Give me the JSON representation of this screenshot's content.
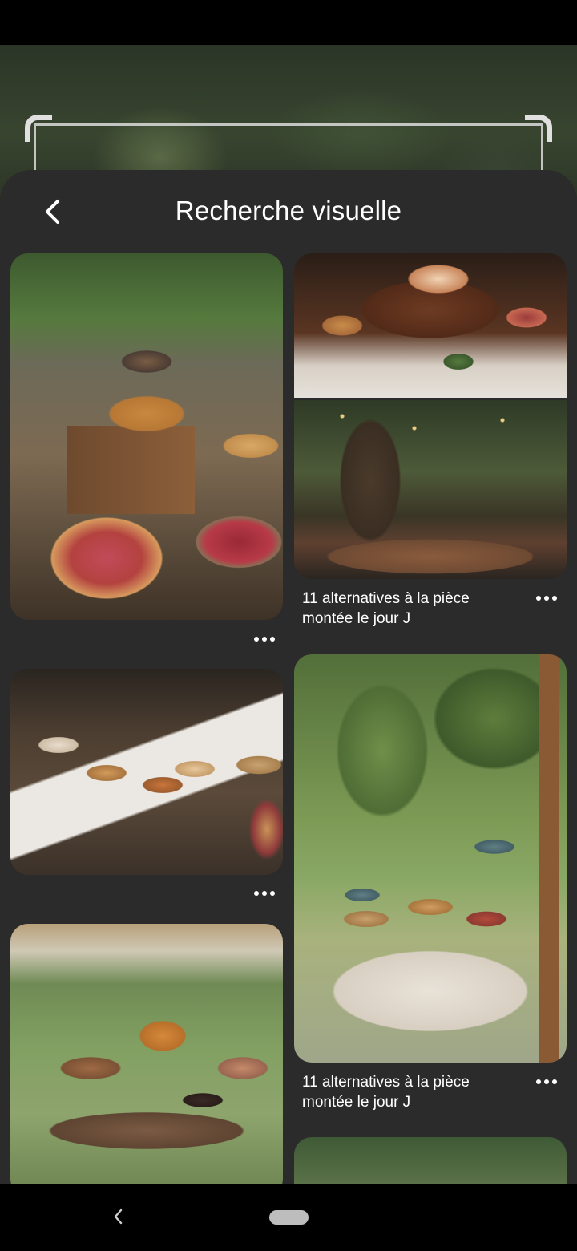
{
  "header": {
    "title": "Recherche visuelle"
  },
  "icons": {
    "back": "chevron-left-icon",
    "more": "more-horizontal-icon",
    "nav_back": "nav-back-icon",
    "nav_home": "home-pill"
  },
  "colors": {
    "sheet_bg": "#2b2b2b",
    "text": "#ffffff",
    "nav_bg": "#000000"
  },
  "pins": [
    {
      "id": "pin-pies-rustic",
      "caption": ""
    },
    {
      "id": "pin-pie-table-garden",
      "caption": "11 alternatives à la pièce montée le jour J"
    },
    {
      "id": "pin-pies-stumps",
      "caption": ""
    },
    {
      "id": "pin-round-table",
      "caption": "11 alternatives à la pièce montée le jour J"
    },
    {
      "id": "pin-donuts",
      "caption": ""
    },
    {
      "id": "pin-partial",
      "caption": ""
    }
  ]
}
